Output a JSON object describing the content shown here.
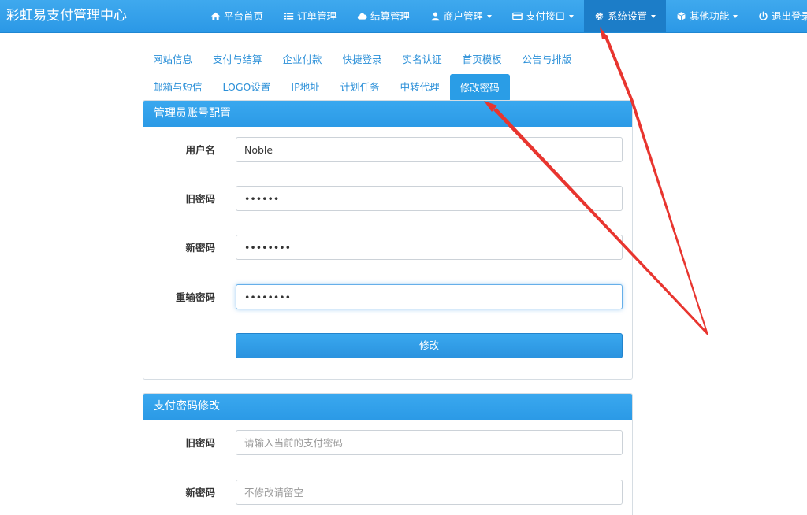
{
  "brand": "彩虹易支付管理中心",
  "nav": [
    {
      "label": "平台首页",
      "icon": "home-icon",
      "dropdown": false,
      "active": false
    },
    {
      "label": "订单管理",
      "icon": "list-icon",
      "dropdown": false,
      "active": false
    },
    {
      "label": "结算管理",
      "icon": "cloud-icon",
      "dropdown": false,
      "active": false
    },
    {
      "label": "商户管理",
      "icon": "user-icon",
      "dropdown": true,
      "active": false
    },
    {
      "label": "支付接口",
      "icon": "credit-card-icon",
      "dropdown": true,
      "active": false
    },
    {
      "label": "系统设置",
      "icon": "gear-icon",
      "dropdown": true,
      "active": true
    },
    {
      "label": "其他功能",
      "icon": "cube-icon",
      "dropdown": true,
      "active": false
    },
    {
      "label": "退出登录",
      "icon": "power-icon",
      "dropdown": false,
      "active": false
    }
  ],
  "tabs_row1": [
    "网站信息",
    "支付与结算",
    "企业付款",
    "快捷登录",
    "实名认证",
    "首页模板",
    "公告与排版"
  ],
  "tabs_row2": [
    "邮箱与短信",
    "LOGO设置",
    "IP地址",
    "计划任务",
    "中转代理",
    "修改密码"
  ],
  "active_tab": "修改密码",
  "admin_panel": {
    "title": "管理员账号配置",
    "fields": [
      {
        "label": "用户名",
        "value": "Noble",
        "placeholder": ""
      },
      {
        "label": "旧密码",
        "value": "••••••",
        "placeholder": ""
      },
      {
        "label": "新密码",
        "value": "••••••••",
        "placeholder": ""
      },
      {
        "label": "重输密码",
        "value": "••••••••",
        "placeholder": ""
      }
    ],
    "submit_label": "修改"
  },
  "pay_panel": {
    "title": "支付密码修改",
    "fields": [
      {
        "label": "旧密码",
        "value": "",
        "placeholder": "请输入当前的支付密码"
      },
      {
        "label": "新密码",
        "value": "",
        "placeholder": "不修改请留空"
      }
    ]
  },
  "colors": {
    "navbar": "#2b98e6",
    "nav_active": "#1c7dc8",
    "link": "#2a8fd8",
    "annotation_arrow": "#e8352f"
  }
}
